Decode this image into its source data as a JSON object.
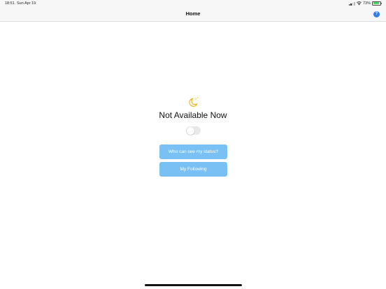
{
  "status_bar": {
    "time": "18:51",
    "date": "Sun Apr 19",
    "battery_percent_label": "73%",
    "battery_level": 0.73
  },
  "nav": {
    "title": "Home",
    "help_label": "?"
  },
  "main": {
    "status_icon": "moon-sleep-icon",
    "status_text": "Not Available Now",
    "toggle_on": false,
    "buttons": {
      "who_can_see": "Who can see my status?",
      "my_following": "My Following"
    }
  },
  "colors": {
    "accent_button": "#79c1f4",
    "help_button": "#2f7cf6",
    "moon": "#f2b51c"
  }
}
